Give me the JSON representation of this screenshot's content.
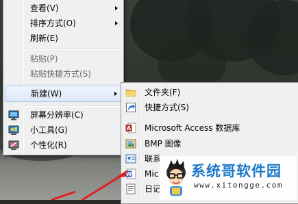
{
  "context_menu": {
    "items": [
      {
        "label": "查看(V)",
        "has_submenu": true,
        "disabled": false
      },
      {
        "label": "排序方式(O)",
        "has_submenu": true,
        "disabled": false
      },
      {
        "label": "刷新(E)",
        "has_submenu": false,
        "disabled": false
      },
      {
        "label": "粘贴(P)",
        "has_submenu": false,
        "disabled": true
      },
      {
        "label": "粘贴快捷方式(S)",
        "has_submenu": false,
        "disabled": true
      },
      {
        "label": "新建(W)",
        "has_submenu": true,
        "disabled": false,
        "highlighted": true
      },
      {
        "label": "屏幕分辨率(C)",
        "icon": "screen-resolution-icon"
      },
      {
        "label": "小工具(G)",
        "icon": "gadgets-icon"
      },
      {
        "label": "个性化(R)",
        "icon": "personalize-icon"
      }
    ]
  },
  "new_submenu": {
    "items": [
      {
        "label": "文件夹(F)",
        "icon": "folder-icon"
      },
      {
        "label": "快捷方式(S)",
        "icon": "shortcut-icon"
      },
      {
        "label": "Microsoft Access 数据库",
        "icon": "access-icon"
      },
      {
        "label": "BMP 图像",
        "icon": "bmp-image-icon"
      },
      {
        "label": "联系",
        "icon": "contact-icon"
      },
      {
        "label": "Mic",
        "icon": "word-document-icon"
      },
      {
        "label": "日记",
        "icon": "journal-icon"
      }
    ]
  },
  "watermark": {
    "title": "系统哥软件园",
    "url": "www.xitongge.com"
  },
  "colors": {
    "menu_bg": "#f0f0f0",
    "highlight_border": "#a8c6ec",
    "watermark_blue": "#1d7ac9",
    "arrow_red": "#e02020"
  }
}
